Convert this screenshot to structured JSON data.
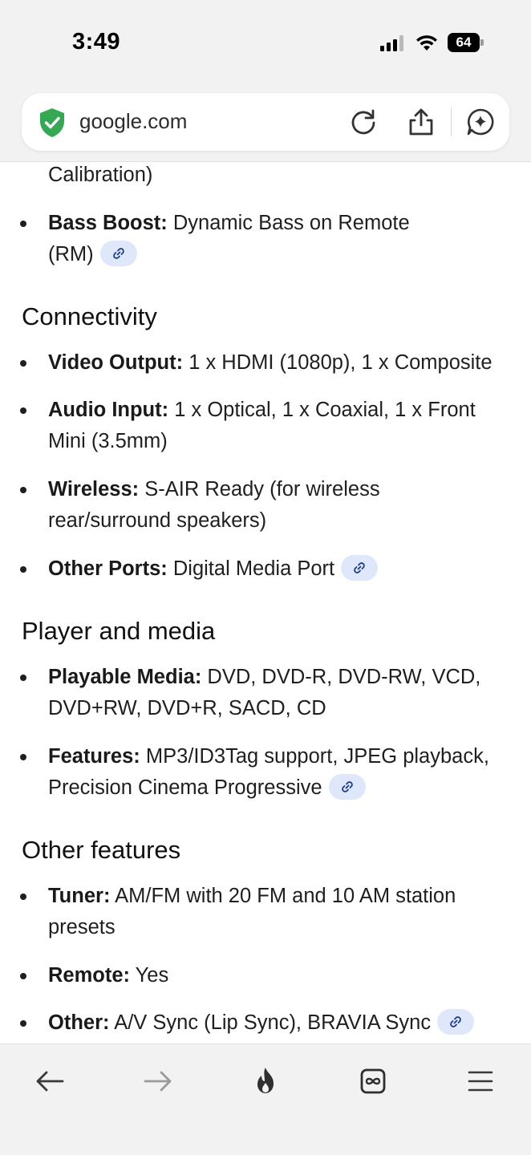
{
  "status_bar": {
    "time": "3:49",
    "battery": "64"
  },
  "browser": {
    "url": "google.com",
    "icons": [
      "shield-check-icon",
      "reload-icon",
      "share-icon",
      "ai-sparkle-icon"
    ]
  },
  "content": {
    "intro_fragment": "Calibration)",
    "bass_boost": {
      "label": "Bass Boost:",
      "text_1": "Dynamic Bass on Remote",
      "text_2": "(RM)"
    },
    "sections": [
      {
        "heading": "Connectivity",
        "items": [
          {
            "label": "Video Output:",
            "lines": [
              "1 x HDMI (1080p), 1 x Composite"
            ]
          },
          {
            "label": "Audio Input:",
            "lines": [
              "1 x Optical, 1 x Coaxial, 1 x Front",
              "Mini (3.5mm)"
            ]
          },
          {
            "label": "Wireless:",
            "lines": [
              "S-AIR Ready (for wireless",
              "rear/surround speakers)"
            ]
          },
          {
            "label": "Other Ports:",
            "lines": [
              "Digital Media Port"
            ]
          }
        ]
      },
      {
        "heading": "Player and media",
        "items": [
          {
            "label": "Playable Media:",
            "lines": [
              "DVD, DVD-R, DVD-RW, VCD,",
              "DVD+RW, DVD+R, SACD, CD"
            ]
          },
          {
            "label": "Features:",
            "lines": [
              "MP3/ID3Tag support, JPEG playback,",
              "Precision Cinema Progressive"
            ]
          }
        ]
      },
      {
        "heading": "Other features",
        "items": [
          {
            "label": "Tuner:",
            "lines": [
              "AM/FM with 20 FM and 10 AM station",
              "presets"
            ]
          },
          {
            "label": "Remote:",
            "lines": [
              "Yes"
            ]
          },
          {
            "label": "Other:",
            "lines": [
              "A/V Sync (Lip Sync), BRAVIA Sync"
            ]
          }
        ]
      }
    ]
  },
  "bottom_nav": {
    "icons": [
      "back-arrow-icon",
      "forward-arrow-icon",
      "flame-icon",
      "tabs-infinity-icon",
      "menu-icon"
    ]
  },
  "colors": {
    "chrome_bg": "#f2f2f3",
    "chip_bg": "#dfe8fb",
    "shield_green": "#34a853",
    "text": "#1f1f1f"
  }
}
